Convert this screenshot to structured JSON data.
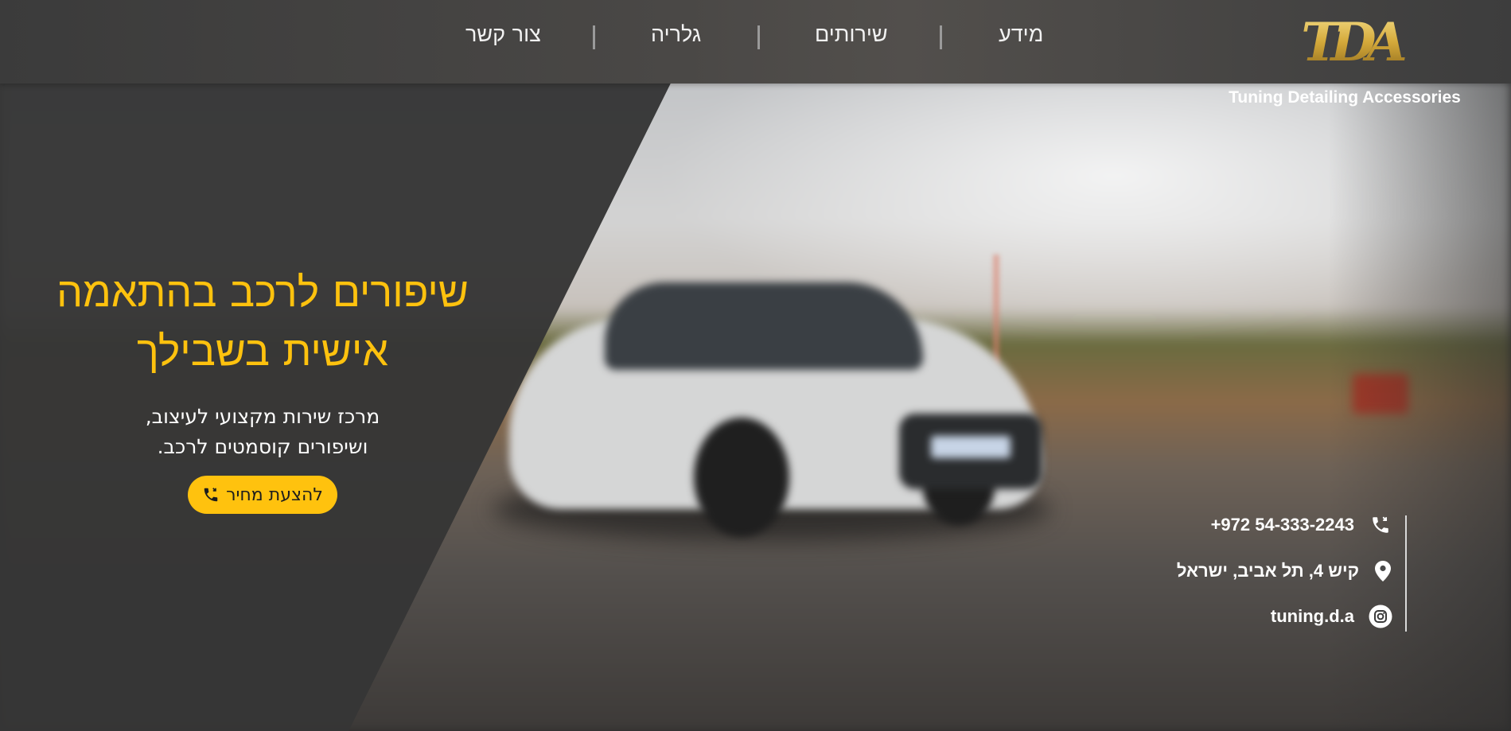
{
  "nav": {
    "items": [
      "מידע",
      "שירותים",
      "גלריה",
      "צור קשר"
    ]
  },
  "brand": {
    "logo_text": "TDA",
    "tagline": "Tuning Detailing Accessories",
    "logo_color": "#d4a93a"
  },
  "hero": {
    "title_line1": "שיפורים לרכב בהתאמה",
    "title_line2": "אישית בשבילך",
    "subtitle_line1": "מרכז שירות מקצועי לעיצוב,",
    "subtitle_line2": "ושיפורים קוסמטים לרכב.",
    "cta_label": "להצעת מחיר",
    "cta_icon": "phone-icon"
  },
  "contact": {
    "phone": "+972 54-333-2243",
    "phone_icon": "phone-icon",
    "address": "קיש 4, תל אביב, ישראל",
    "address_icon": "map-pin-icon",
    "instagram": "tuning.d.a",
    "instagram_icon": "instagram-icon"
  },
  "colors": {
    "accent": "#ffc20e",
    "panel": "#363636",
    "header": "#4a4846"
  }
}
